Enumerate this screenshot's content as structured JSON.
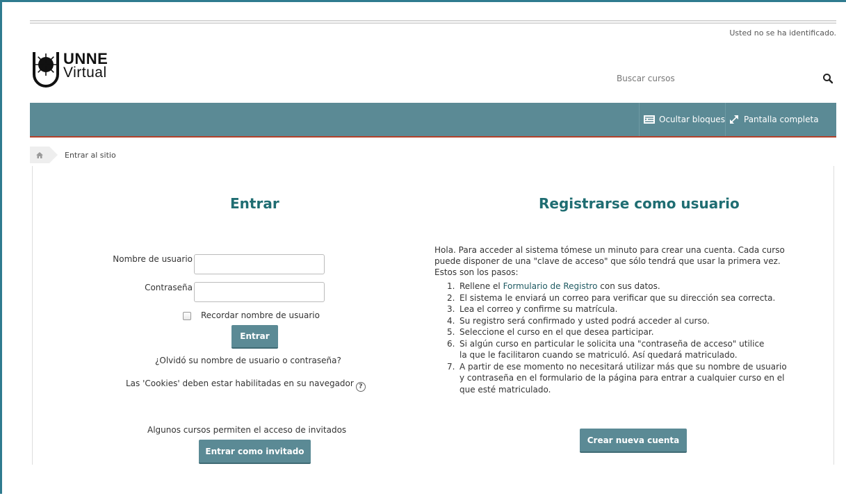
{
  "header": {
    "login_info": "Usted no se ha identificado.",
    "logo": {
      "line1": "UNNE",
      "line2": "Virtual"
    },
    "search": {
      "placeholder": "Buscar cursos"
    }
  },
  "navbar": {
    "hide_blocks": "Ocultar bloques",
    "fullscreen": "Pantalla completa",
    "bg_color": "#5b8a95",
    "accent_color": "#b3402a"
  },
  "breadcrumb": {
    "current": "Entrar al sitio"
  },
  "login": {
    "title": "Entrar",
    "username_label": "Nombre de usuario",
    "password_label": "Contraseña",
    "remember_label": "Recordar nombre de usuario",
    "submit_label": "Entrar",
    "forgot_link": "¿Olvidó su nombre de usuario o contraseña?",
    "cookies_notice": "Las 'Cookies' deben estar habilitadas en su navegador",
    "guest_notice": "Algunos cursos permiten el acceso de invitados",
    "guest_button": "Entrar como invitado"
  },
  "signup": {
    "title": "Registrarse como usuario",
    "intro": "Hola. Para acceder al sistema tómese un minuto para crear una cuenta. Cada curso puede disponer de una \"clave de acceso\" que sólo tendrá que usar la primera vez. Estos son los pasos:",
    "step1_prefix": "Rellene el ",
    "step1_link": "Formulario de Registro",
    "step1_suffix": " con sus datos.",
    "steps": [
      "El sistema le enviará un correo para verificar que su dirección sea correcta.",
      "Lea el correo y confirme su matrícula.",
      "Su registro será confirmado y usted podrá acceder al curso.",
      "Seleccione el curso en el que desea participar.",
      "Si algún curso en particular le solicita una \"contraseña de acceso\" utilice la que le facilitaron cuando se matriculó. Así quedará matriculado.",
      "A partir de ese momento no necesitará utilizar más que su nombre de usuario y contraseña en el formulario de la página para entrar a cualquier curso en el que esté matriculado."
    ],
    "numbers": [
      "1.",
      "2.",
      "3.",
      "4.",
      "5.",
      "6.",
      "7."
    ],
    "create_button": "Crear nueva cuenta"
  }
}
